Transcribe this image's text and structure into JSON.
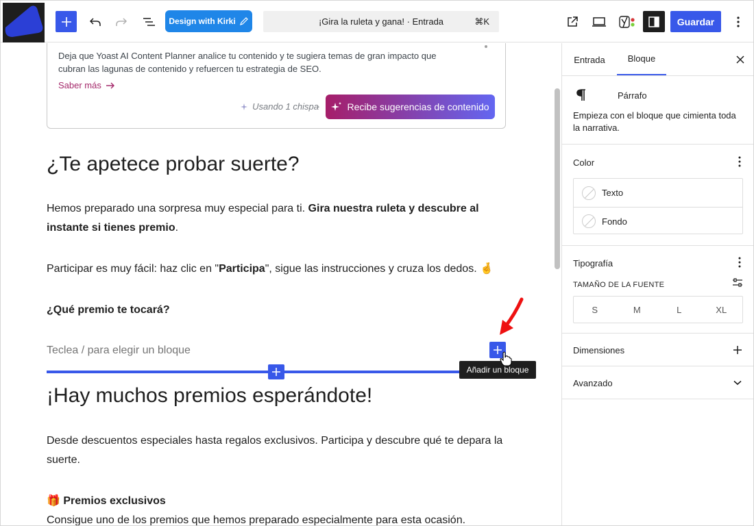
{
  "toolbar": {
    "kirki_label": "Design with Kirki",
    "command_title": "¡Gira la ruleta y gana! · Entrada",
    "command_shortcut": "⌘K",
    "save_label": "Guardar"
  },
  "yoast": {
    "description": "Deja que Yoast AI Content Planner analice tu contenido y te sugiera temas de gran impacto que cubran las lagunas de contenido y refuercen tu estrategia de SEO.",
    "learn_more": "Saber más",
    "spark_note": "Usando 1 chispa",
    "cta_label": "Recibe sugerencias de contenido"
  },
  "content": {
    "heading1": "¿Te apetece probar suerte?",
    "p1_text": "Hemos preparado una sorpresa muy especial para ti.",
    "p1_bold": "Gira nuestra ruleta y descubre al instante si tienes premio",
    "p1_end": ".",
    "p2_start": "Participar es muy fácil: haz clic en \"",
    "p2_bold": "Participa",
    "p2_end": "\", sigue las instrucciones y cruza los dedos. 🤞",
    "p3_bold": "¿Qué premio te tocará?",
    "placeholder": "Teclea / para elegir un bloque",
    "tooltip": "Añadir un bloque",
    "heading2": "¡Hay muchos premios esperándote!",
    "p4": "Desde descuentos especiales hasta regalos exclusivos. Participa y descubre qué te depara la suerte.",
    "p5_bold": "🎁 Premios exclusivos",
    "p6": "Consigue uno de los premios que hemos preparado especialmente para esta ocasión."
  },
  "sidebar": {
    "tab_entrada": "Entrada",
    "tab_bloque": "Bloque",
    "block_name": "Párrafo",
    "block_desc": "Empieza con el bloque que cimienta toda la narrativa.",
    "color_title": "Color",
    "color_text": "Texto",
    "color_background": "Fondo",
    "typography_title": "Tipografía",
    "font_size_label": "TAMAÑO DE LA FUENTE",
    "sizes": [
      "S",
      "M",
      "L",
      "XL"
    ],
    "dimensions_title": "Dimensiones",
    "advanced_title": "Avanzado"
  },
  "colors": {
    "accent": "#3858e9",
    "kirki": "#1f86e8",
    "yoast_link": "#a4286a"
  }
}
